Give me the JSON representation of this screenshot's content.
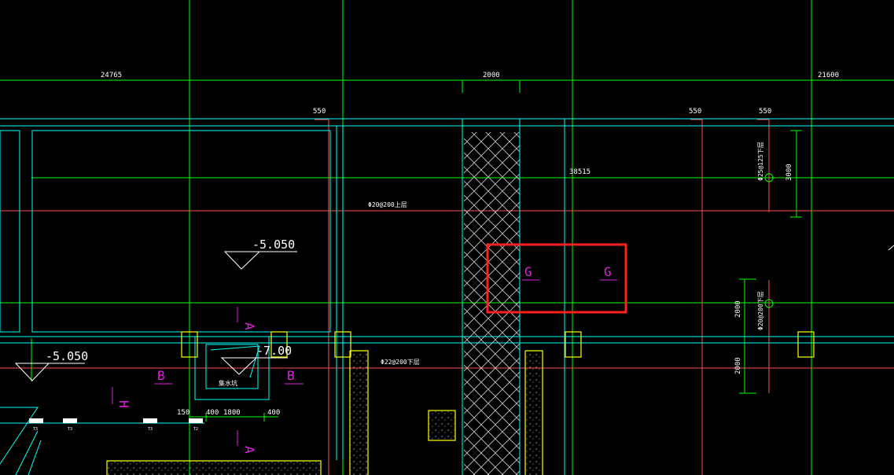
{
  "drawing": {
    "dimensions": {
      "d24765": "24765",
      "d2000_top": "2000",
      "d21600": "21600",
      "d550_a": "550",
      "d550_b": "550",
      "d550_c": "550",
      "d38515": "38515",
      "d3000": "3000",
      "d2000_v1": "2000",
      "d2000_v2": "2000",
      "d150": "150",
      "d400_a": "400",
      "d1800": "1800",
      "d400_b": "400"
    },
    "levels": {
      "level_main": "-5.050",
      "level_left": "-5.050",
      "level_pit": "-7.00"
    },
    "rebar_notes": {
      "note_20_200": "Φ20@200上层",
      "note_22_200": "Φ22@200下层",
      "note_25_125": "Φ25@125下层",
      "note_20_200_v": "Φ20@200下层"
    },
    "section_marks": {
      "g_left": "G",
      "g_right": "G",
      "b_left": "B",
      "b_right": "B",
      "a_top": "A",
      "a_bottom": "A",
      "h_left": "H"
    },
    "pit_label": "集水坑",
    "axis_tags": [
      "T3",
      "T3",
      "T3",
      "T2"
    ],
    "colors": {
      "background": "#000000",
      "green": "#00ff00",
      "cyan": "#00ffff",
      "red": "#ff5050",
      "magenta": "#e020e0",
      "yellow": "#ffff00",
      "white": "#ffffff",
      "highlight": "#ff2020"
    }
  }
}
